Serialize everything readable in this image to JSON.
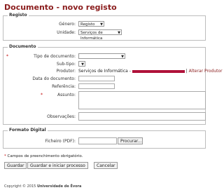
{
  "page_title": "Documento - novo registo",
  "registo": {
    "legend": "Registo",
    "genero_label": "Género:",
    "genero_value": "Registo",
    "unidade_label": "Unidade:",
    "unidade_value": "Serviços de Informática"
  },
  "documento": {
    "legend": "Documento",
    "tipo_label": "Tipo de documento:",
    "tipo_value": "",
    "subtipo_label": "Sub-tipo:",
    "subtipo_value": "",
    "produtor_label": "Produtor:",
    "produtor_value": "Serviços de Informática - ",
    "produtor_sep": " | ",
    "alterar_produtor": "Alterar Produtor",
    "data_label": "Data do documento:",
    "referencia_label": "Referência:",
    "assunto_label": "Assunto:",
    "observacoes_label": "Observações:"
  },
  "formato": {
    "legend": "Formato Digital",
    "ficheiro_label": "Ficheiro (PDF):",
    "procurar_label": "Procurar..."
  },
  "required_note": "Campos de preenchimento obrigatório.",
  "required_mark": "*",
  "buttons": {
    "guardar": "Guardar",
    "guardar_iniciar": "Guardar e iniciar processo",
    "cancelar": "Cancelar"
  },
  "footer": {
    "prefix": "Copyright © 2015 ",
    "org": "Universidade de Évora"
  },
  "icons": {
    "dropdown": "chevron-down-icon"
  },
  "colors": {
    "title": "#8a1c1c",
    "required": "#c00000",
    "redaction": "#b0123a"
  }
}
